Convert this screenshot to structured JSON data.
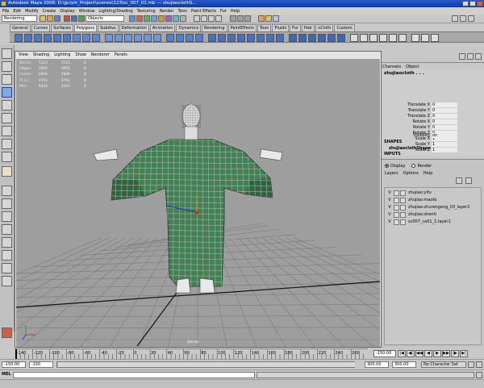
{
  "app": {
    "title": "Autodesk Maya 2008: D:\\guiyin_Project\\scenes\\123\\sc_007_01.mb  ---  zhujiaoclothS..."
  },
  "menu": [
    "File",
    "Edit",
    "Modify",
    "Create",
    "Display",
    "Window",
    "Lighting/Shading",
    "Texturing",
    "Render",
    "Toon",
    "Paint Effects",
    "Fur",
    "Help"
  ],
  "status_line": {
    "mode": "Rendering",
    "objects_field": "Objects"
  },
  "shelf": {
    "tabs": [
      "General",
      "Curves",
      "Surfaces",
      "Polygons",
      "Subdivs",
      "Deformation",
      "Animation",
      "Dynamics",
      "Rendering",
      "PaintEffects",
      "Toon",
      "Fluids",
      "Fur",
      "Hair",
      "nCloth",
      "Custom"
    ],
    "active_tab": "Polygons"
  },
  "viewport": {
    "menu": [
      "View",
      "Shading",
      "Lighting",
      "Show",
      "Renderer",
      "Panels"
    ],
    "hud": [
      {
        "label": "Verts:",
        "v1": "5113",
        "v2": "5113",
        "v3": "0"
      },
      {
        "label": "Edges:",
        "v1": "9956",
        "v2": "9956",
        "v3": "0"
      },
      {
        "label": "Faces:",
        "v1": "4846",
        "v2": "4846",
        "v3": "0"
      },
      {
        "label": "Tris:",
        "v1": "9791",
        "v2": "9791",
        "v3": "0"
      },
      {
        "label": "UVs:",
        "v1": "6433",
        "v2": "6433",
        "v3": "0"
      }
    ],
    "camera": "persp"
  },
  "channel_box": {
    "tabs": [
      "Channels",
      "Object"
    ],
    "object_name": "zhujiaocloth . . .",
    "attributes": [
      {
        "name": "Translate X",
        "value": "0"
      },
      {
        "name": "Translate Y",
        "value": "0"
      },
      {
        "name": "Translate Z",
        "value": "0"
      },
      {
        "name": "Rotate X",
        "value": "0"
      },
      {
        "name": "Rotate Y",
        "value": "0"
      },
      {
        "name": "Rotate Z",
        "value": "0"
      },
      {
        "name": "Scale X",
        "value": "1"
      },
      {
        "name": "Scale Y",
        "value": "1"
      },
      {
        "name": "Scale Z",
        "value": "1"
      },
      {
        "name": "Visibility",
        "value": "on"
      }
    ],
    "shapes_header": "SHAPES",
    "shape_name": "zhujiaoclothShape",
    "inputs_header": "INPUTS"
  },
  "layers": {
    "radio_display": "Display",
    "radio_render": "Render",
    "menu": [
      "Layers",
      "Options",
      "Help"
    ],
    "items": [
      {
        "vis": "V",
        "name": "zhujiao:yifu"
      },
      {
        "vis": "V",
        "name": "zhujiao:maofa"
      },
      {
        "vis": "V",
        "name": "zhujiao:zhurengong_03_layer2"
      },
      {
        "vis": "V",
        "name": "zhujiao:shenti"
      },
      {
        "vis": "V",
        "name": "sc007_ca01_1:layer1"
      }
    ]
  },
  "timeline": {
    "ticks": [
      "-140",
      "-120",
      "-100",
      "-80",
      "-60",
      "-40",
      "-20",
      "0",
      "20",
      "40",
      "60",
      "80",
      "100",
      "120",
      "140",
      "160",
      "180",
      "200",
      "220",
      "240",
      "260",
      "280"
    ],
    "current_frame": "-150.00",
    "playback_buttons": [
      "|◀",
      "◀|",
      "◀◀",
      "◀",
      "▶",
      "▶▶",
      "|▶",
      "▶|"
    ]
  },
  "range": {
    "start": "-150.00",
    "range_start": "-150",
    "range_end": "300.00",
    "end": "300.00",
    "character_set": "No Character Set"
  },
  "command_line": {
    "label": "MEL"
  }
}
